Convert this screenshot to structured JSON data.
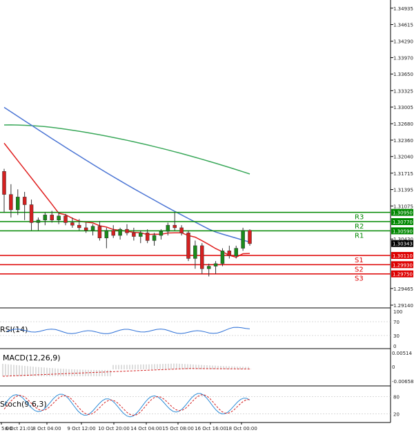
{
  "chart_data": {
    "type": "candlestick",
    "price_axis": {
      "ticks": [
        "1.34935",
        "1.34615",
        "1.34290",
        "1.33970",
        "1.33650",
        "1.33325",
        "1.33005",
        "1.32680",
        "1.32360",
        "1.32040",
        "1.31715",
        "1.31395",
        "1.31075",
        "1.30430",
        "1.29465",
        "1.29140"
      ],
      "range": [
        1.2914,
        1.35
      ]
    },
    "time_axis": {
      "ticks": [
        "5:00",
        "6 Oct 21:01",
        "8 Oct 04:00",
        "9 Oct 12:00",
        "10 Oct 20:00",
        "14 Oct 04:00",
        "15 Oct 08:00",
        "16 Oct 16:00",
        "18 Oct 00:00"
      ]
    },
    "current_price": "1.30343",
    "levels": [
      {
        "name": "R3",
        "value": "1.30950",
        "color": "#008800"
      },
      {
        "name": "R2",
        "value": "1.30770",
        "color": "#008800"
      },
      {
        "name": "R1",
        "value": "1.30590",
        "color": "#008800"
      },
      {
        "name": "S1",
        "value": "1.30110",
        "color": "#dd0000"
      },
      {
        "name": "S2",
        "value": "1.29930",
        "color": "#dd0000"
      },
      {
        "name": "S3",
        "value": "1.29750",
        "color": "#dd0000"
      }
    ],
    "candles": [
      [
        1.3175,
        1.318,
        1.3095,
        1.313
      ],
      [
        1.313,
        1.315,
        1.3085,
        1.31
      ],
      [
        1.31,
        1.314,
        1.309,
        1.3125
      ],
      [
        1.3125,
        1.3135,
        1.308,
        1.311
      ],
      [
        1.311,
        1.312,
        1.306,
        1.3075
      ],
      [
        1.3075,
        1.3085,
        1.306,
        1.308
      ],
      [
        1.308,
        1.3095,
        1.307,
        1.309
      ],
      [
        1.309,
        1.3098,
        1.3075,
        1.308
      ],
      [
        1.308,
        1.3095,
        1.3072,
        1.3088
      ],
      [
        1.3088,
        1.3092,
        1.307,
        1.3075
      ],
      [
        1.3075,
        1.3085,
        1.3065,
        1.307
      ],
      [
        1.307,
        1.3082,
        1.306,
        1.3065
      ],
      [
        1.3065,
        1.3075,
        1.3055,
        1.306
      ],
      [
        1.306,
        1.3072,
        1.305,
        1.3068
      ],
      [
        1.3068,
        1.3078,
        1.304,
        1.3045
      ],
      [
        1.3045,
        1.3065,
        1.3025,
        1.306
      ],
      [
        1.306,
        1.307,
        1.3045,
        1.305
      ],
      [
        1.305,
        1.3065,
        1.3042,
        1.3062
      ],
      [
        1.3062,
        1.3072,
        1.305,
        1.3055
      ],
      [
        1.3055,
        1.3065,
        1.304,
        1.3048
      ],
      [
        1.3048,
        1.306,
        1.3035,
        1.3055
      ],
      [
        1.3055,
        1.3062,
        1.3035,
        1.304
      ],
      [
        1.304,
        1.3055,
        1.303,
        1.305
      ],
      [
        1.305,
        1.3062,
        1.3042,
        1.3058
      ],
      [
        1.3058,
        1.3075,
        1.305,
        1.307
      ],
      [
        1.307,
        1.3095,
        1.306,
        1.3065
      ],
      [
        1.3065,
        1.307,
        1.305,
        1.3055
      ],
      [
        1.3055,
        1.306,
        1.3,
        1.3005
      ],
      [
        1.3005,
        1.304,
        1.2985,
        1.303
      ],
      [
        1.303,
        1.3035,
        1.2975,
        1.2985
      ],
      [
        1.2985,
        1.2995,
        1.297,
        1.299
      ],
      [
        1.299,
        1.3,
        1.2975,
        1.2995
      ],
      [
        1.2995,
        1.3025,
        1.299,
        1.302
      ],
      [
        1.302,
        1.303,
        1.3005,
        1.301
      ],
      [
        1.301,
        1.303,
        1.3005,
        1.3025
      ],
      [
        1.3025,
        1.3065,
        1.302,
        1.306
      ],
      [
        1.306,
        1.3062,
        1.303,
        1.3034
      ]
    ],
    "indicators": [
      {
        "name": "RSI(14)",
        "ticks": [
          "100",
          "70",
          "30",
          "0"
        ],
        "range": [
          0,
          100
        ]
      },
      {
        "name": "MACD(12,26,9)",
        "ticks": [
          "0.00514",
          "0",
          "-0.00658"
        ],
        "range": [
          -0.00658,
          0.00514
        ]
      },
      {
        "name": "Stoch(9,6,3)",
        "ticks": [
          "80",
          "20"
        ],
        "range": [
          0,
          100
        ]
      }
    ]
  }
}
